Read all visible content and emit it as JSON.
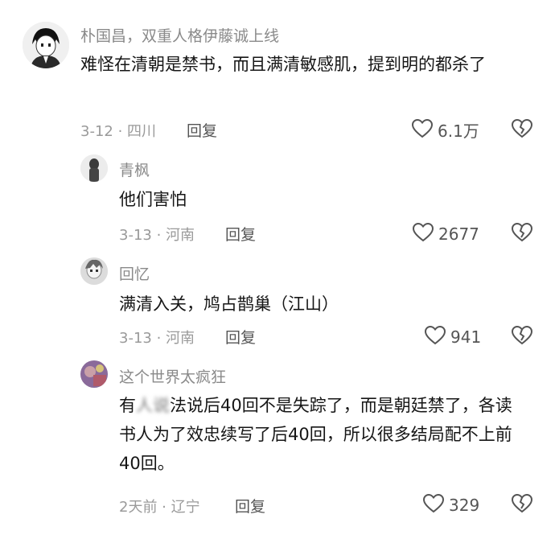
{
  "comments": [
    {
      "username": "朴国昌，双重人格伊藤诚上线",
      "text": "难怪在清朝是禁书，而且满清敏感肌，提到明的都杀了",
      "meta": "3-12 · 四川",
      "reply_label": "回复",
      "likes": "6.1万"
    },
    {
      "username": "青枫",
      "text": "他们害怕",
      "meta": "3-13 · 河南",
      "reply_label": "回复",
      "likes": "2677"
    },
    {
      "username": "回忆",
      "text": "满清入关，鸠占鹊巢（江山）",
      "meta": "3-13 · 河南",
      "reply_label": "回复",
      "likes": "941"
    },
    {
      "username": "这个世界太疯狂",
      "text_pre": "有",
      "text_blur": "人说",
      "text_post": "法说后40回不是失踪了，而是朝廷禁了，各读书人为了效忠续写了后40回，所以很多结局配不上前40回。",
      "meta": "2天前 · 辽宁",
      "reply_label": "回复",
      "likes": "329"
    }
  ],
  "icons": {
    "like": "heart-outline-icon",
    "dislike": "broken-heart-icon"
  },
  "colors": {
    "text": "#161616",
    "muted": "#9a9a9a",
    "username": "#8a8a8a"
  }
}
